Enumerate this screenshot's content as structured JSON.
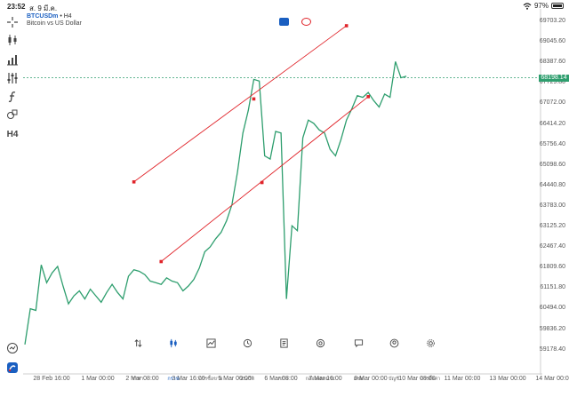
{
  "status_bar": {
    "time": "23:52",
    "date": "ส. 9 มี.ค.",
    "battery": "97%",
    "battery_level": 0.97
  },
  "chart": {
    "symbol": "BTCUSDm",
    "timeframe": "H4",
    "description": "Bitcoin vs US Dollar",
    "current_price": "68198.14",
    "line_color": "#2e9e6e",
    "drawing_color": "#e0242a"
  },
  "toolbar": {
    "items": [
      {
        "name": "crosshair",
        "icon": "crosshair-icon"
      },
      {
        "name": "chart-type",
        "icon": "candles-icon"
      },
      {
        "name": "indicators",
        "icon": "indicators-icon"
      },
      {
        "name": "objects",
        "icon": "sliders-icon"
      },
      {
        "name": "functions",
        "icon": "function-icon"
      },
      {
        "name": "shapes",
        "icon": "shapes-icon"
      }
    ],
    "timeframe_label": "H4"
  },
  "price_axis": [
    "69703.20",
    "69045.60",
    "68387.60",
    "67729.80",
    "67072.00",
    "66414.20",
    "65756.40",
    "65098.60",
    "64440.80",
    "63783.00",
    "63125.20",
    "62467.40",
    "61809.60",
    "61151.80",
    "60494.00",
    "59836.20",
    "59178.40"
  ],
  "time_axis": [
    "28 Feb 16:00",
    "1 Mar 00:00",
    "2 Mar 08:00",
    "3 Mar 16:00",
    "5 Mar 00:00",
    "6 Mar 08:00",
    "7 Mar 16:00",
    "9 Mar 00:00",
    "10 Mar 08:00",
    "11 Mar 00:00",
    "13 Mar 00:00",
    "14 Mar 00:00"
  ],
  "tabs": [
    {
      "label": "ราคา",
      "icon": "quotes-icon"
    },
    {
      "label": "กราฟ",
      "icon": "chart-icon",
      "active": true
    },
    {
      "label": "การซื้อขาย",
      "icon": "trade-icon"
    },
    {
      "label": "ประวัติ",
      "icon": "history-icon"
    },
    {
      "label": "ข่าว",
      "icon": "news-icon"
    },
    {
      "label": "กล่องจดหมาย",
      "icon": "mailbox-icon"
    },
    {
      "label": "แชท",
      "icon": "chat-icon"
    },
    {
      "label": "บัญชี",
      "icon": "account-icon"
    },
    {
      "label": "การตั้งค่า",
      "icon": "settings-icon"
    }
  ],
  "chart_data": {
    "type": "line",
    "x": [
      0,
      1,
      2,
      3,
      4,
      5,
      6,
      7,
      8,
      9,
      10,
      11,
      12,
      13,
      14,
      15,
      16,
      17,
      18,
      19,
      20,
      21,
      22,
      23,
      24,
      25,
      26,
      27,
      28,
      29,
      30,
      31,
      32,
      33,
      34,
      35,
      36,
      37,
      38,
      39,
      40,
      41,
      42,
      43,
      44,
      45,
      46,
      47,
      48,
      49,
      50,
      51,
      52,
      53,
      54,
      55,
      56,
      57,
      58,
      59,
      60,
      61,
      62,
      63,
      64,
      65,
      66,
      67,
      68,
      69,
      70
    ],
    "values": [
      60000,
      61100,
      61050,
      62450,
      61900,
      62200,
      62400,
      61800,
      61250,
      61500,
      61650,
      61400,
      61700,
      61500,
      61300,
      61600,
      61850,
      61600,
      61400,
      62100,
      62300,
      62250,
      62150,
      61950,
      61900,
      61850,
      62050,
      61950,
      61900,
      61650,
      61800,
      62000,
      62350,
      62850,
      63000,
      63250,
      63450,
      63800,
      64300,
      65300,
      66500,
      67200,
      68150,
      68100,
      65800,
      65700,
      66550,
      66500,
      61400,
      63650,
      63500,
      66350,
      66900,
      66800,
      66600,
      66500,
      66000,
      65800,
      66300,
      66900,
      67250,
      67650,
      67600,
      67750,
      67500,
      67300,
      67700,
      67600,
      68700,
      68200,
      68250,
      68300,
      68100
    ],
    "ylim": [
      59178.4,
      70100
    ],
    "drawings": [
      {
        "type": "trendline",
        "points": [
          [
            20.0,
            65000
          ],
          [
            42.0,
            67550
          ],
          [
            59.0,
            69800
          ]
        ]
      },
      {
        "type": "trendline",
        "points": [
          [
            25.0,
            62550
          ],
          [
            43.5,
            64980
          ],
          [
            63.0,
            67620
          ]
        ]
      }
    ]
  }
}
